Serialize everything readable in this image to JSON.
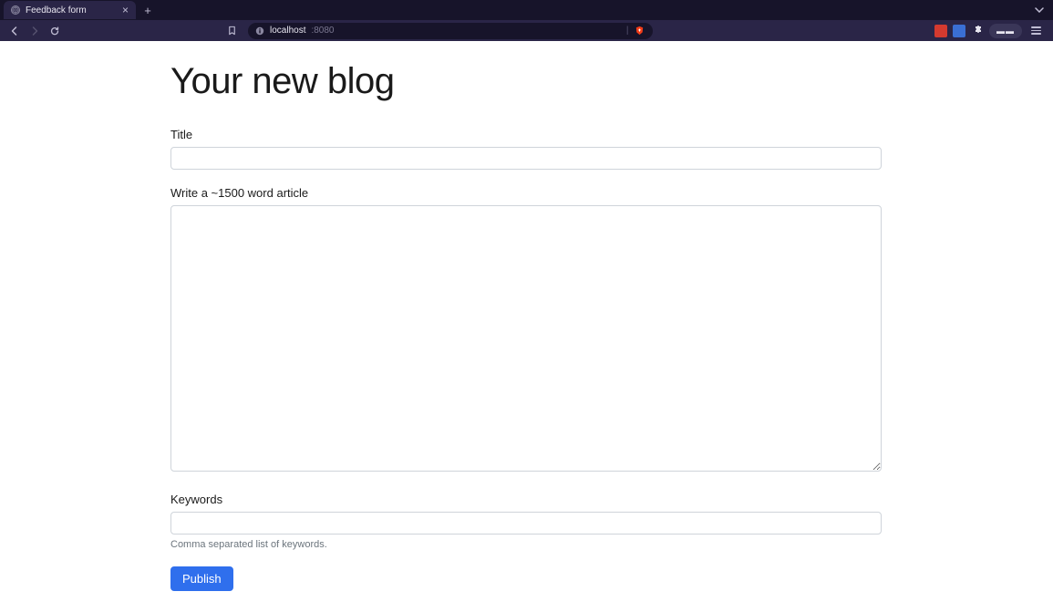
{
  "browser": {
    "tab_title": "Feedback form",
    "url_host": "localhost",
    "url_port": ":8080",
    "profile_label": "▬▬"
  },
  "page": {
    "heading": "Your new blog",
    "title": {
      "label": "Title",
      "value": ""
    },
    "article": {
      "label": "Write a ~1500 word article",
      "value": ""
    },
    "keywords": {
      "label": "Keywords",
      "value": "",
      "hint": "Comma separated list of keywords."
    },
    "submit_label": "Publish"
  }
}
